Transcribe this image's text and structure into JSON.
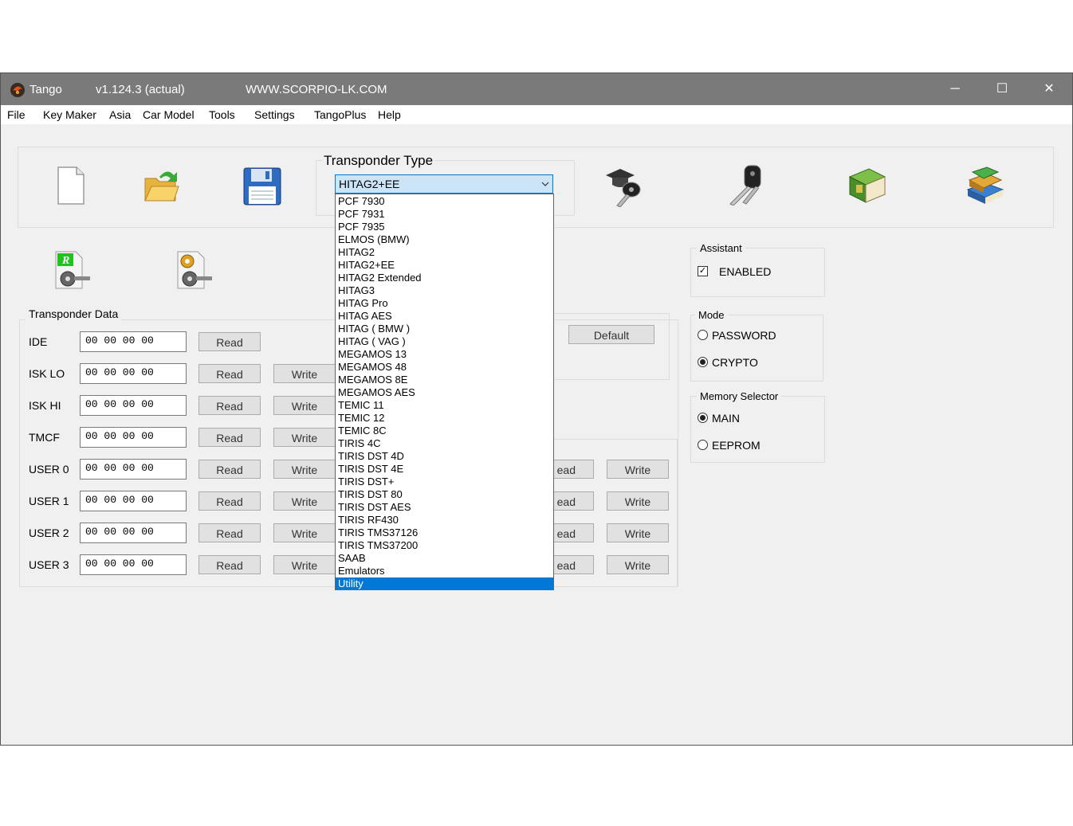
{
  "titlebar": {
    "app_name": "Tango",
    "version": "v1.124.3  (actual)",
    "website": "WWW.SCORPIO-LK.COM",
    "minimize": "─",
    "maximize": "☐",
    "close": "✕"
  },
  "menu": [
    "File",
    "Key Maker",
    "Asia",
    "Car Model",
    "Tools",
    "Settings",
    "TangoPlus",
    "Help"
  ],
  "transponder_type": {
    "label": "Transponder Type",
    "selected": "HITAG2+EE",
    "options": [
      "PCF 7930",
      "PCF 7931",
      "PCF 7935",
      "ELMOS (BMW)",
      "HITAG2",
      "HITAG2+EE",
      "HITAG2 Extended",
      "HITAG3",
      "HITAG Pro",
      "HITAG AES",
      "HITAG ( BMW )",
      "HITAG ( VAG )",
      "MEGAMOS 13",
      "MEGAMOS 48",
      "MEGAMOS 8E",
      "MEGAMOS AES",
      "TEMIC 11",
      "TEMIC 12",
      "TEMIC 8C",
      "TIRIS 4C",
      "TIRIS DST 4D",
      "TIRIS DST 4E",
      "TIRIS DST+",
      "TIRIS DST 80",
      "TIRIS DST AES",
      "TIRIS RF430",
      "TIRIS TMS37126",
      "TIRIS TMS37200",
      "SAAB",
      "Emulators",
      "Utility"
    ],
    "highlighted": "Utility"
  },
  "transponder_data": {
    "label": "Transponder Data",
    "read_label": "Read",
    "write_label": "Write",
    "rows": [
      {
        "label": "IDE",
        "value": "00 00 00 00"
      },
      {
        "label": "ISK LO",
        "value": "00 00 00 00"
      },
      {
        "label": "ISK HI",
        "value": "00 00 00 00"
      },
      {
        "label": "TMCF",
        "value": "00 00 00 00"
      },
      {
        "label": "USER 0",
        "value": "00 00 00 00"
      },
      {
        "label": "USER 1",
        "value": "00 00 00 00"
      },
      {
        "label": "USER 2",
        "value": "00 00 00 00"
      },
      {
        "label": "USER 3",
        "value": "00 00 00 00"
      }
    ],
    "right_read_partial": "ead",
    "default_label": "Default"
  },
  "assistant": {
    "label": "Assistant",
    "enabled_label": "ENABLED",
    "enabled": true
  },
  "mode": {
    "label": "Mode",
    "options": [
      "PASSWORD",
      "CRYPTO"
    ],
    "selected": "CRYPTO"
  },
  "memory_selector": {
    "label": "Memory Selector",
    "options": [
      "MAIN",
      "EEPROM"
    ],
    "selected": "MAIN"
  },
  "colors": {
    "titlebar": "#7a7a7a",
    "selection": "#0078d7",
    "combo_bg": "#cce4f7"
  }
}
